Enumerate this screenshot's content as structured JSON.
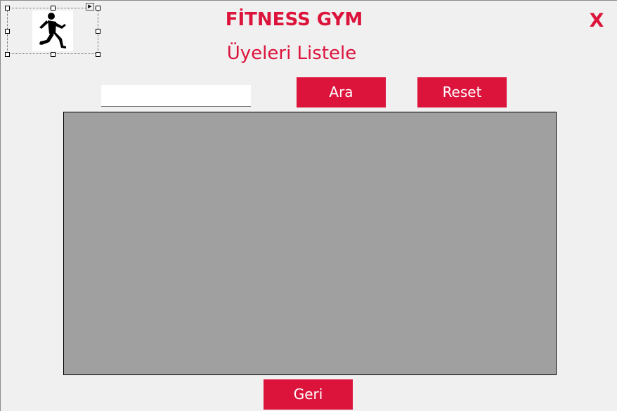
{
  "header": {
    "title": "FİTNESS GYM",
    "subtitle": "Üyeleri Listele",
    "close_label": "X"
  },
  "logo": {
    "icon": "running-man-icon"
  },
  "search": {
    "value": "",
    "placeholder": "",
    "search_button_label": "Ara",
    "reset_button_label": "Reset"
  },
  "grid": {
    "rows": []
  },
  "footer": {
    "back_button_label": "Geri"
  },
  "colors": {
    "accent": "#dc143c",
    "background": "#f0f0f0",
    "grid_background": "#a0a0a0",
    "button_text": "#ffffff"
  }
}
